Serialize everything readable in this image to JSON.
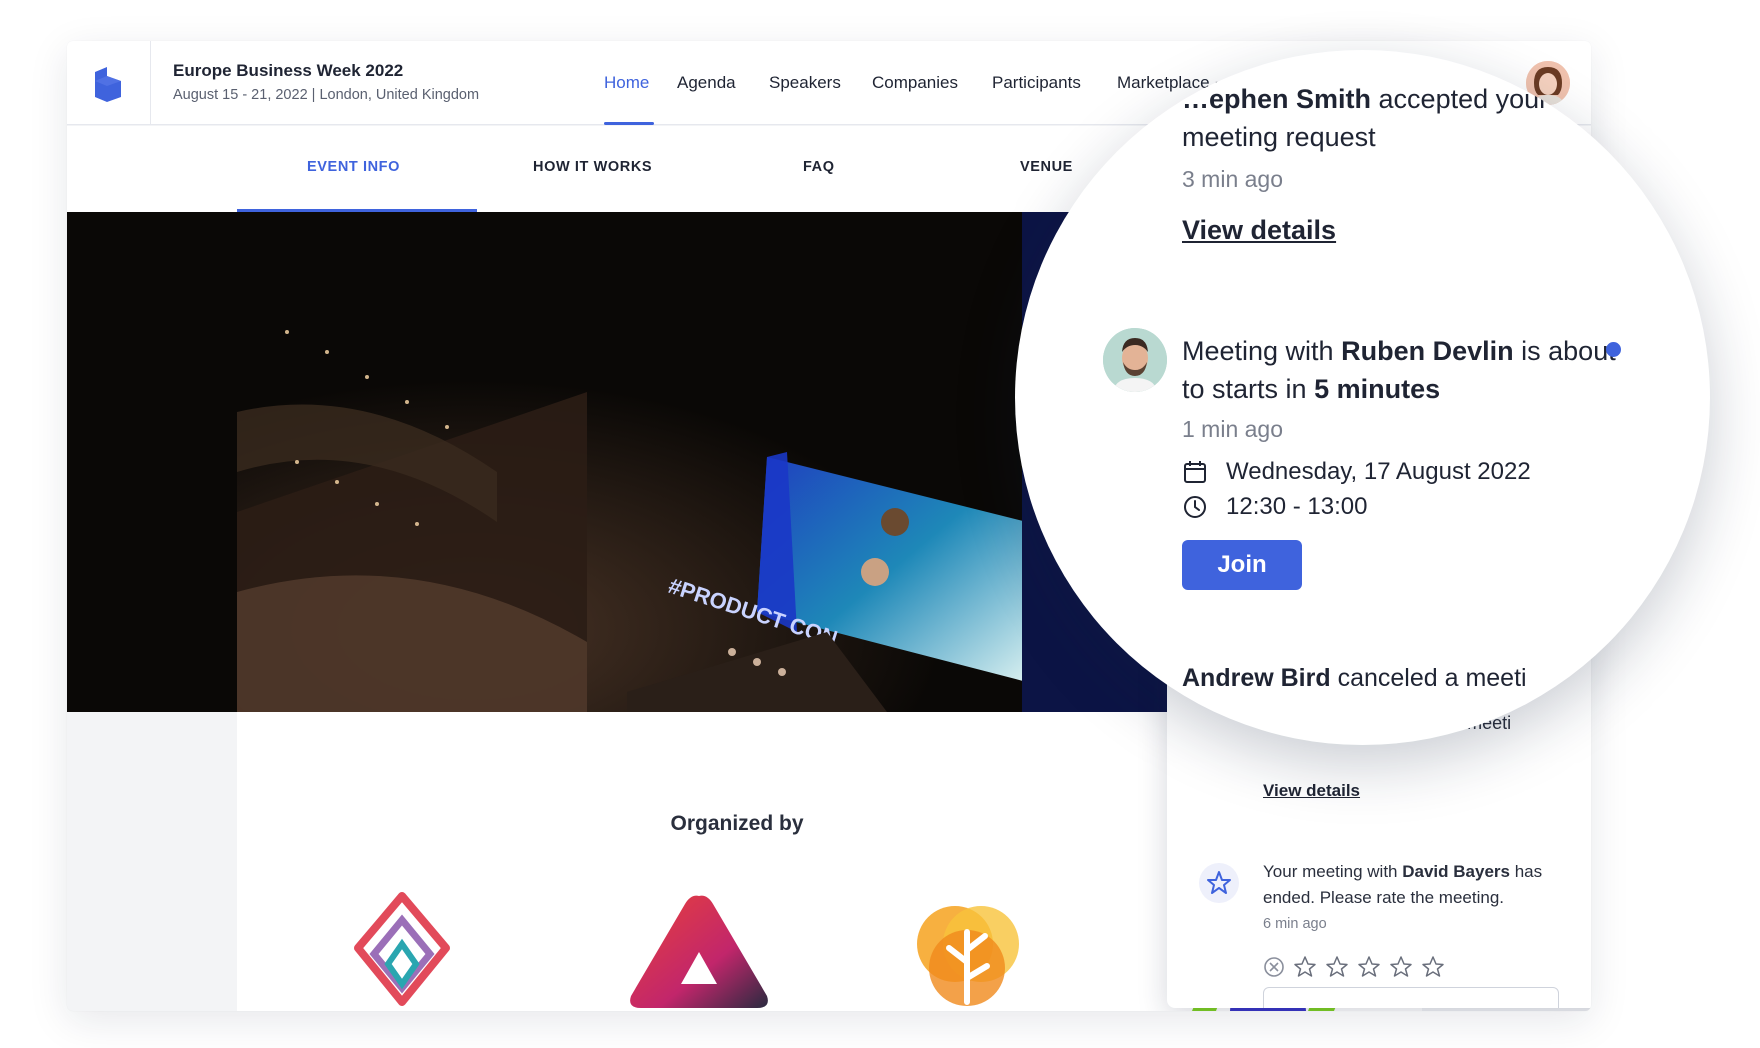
{
  "header": {
    "event_title": "Europe Business Week 2022",
    "event_subtitle": "August 15 - 21, 2022 | London, United Kingdom",
    "nav": [
      {
        "label": "Home",
        "active": true
      },
      {
        "label": "Agenda"
      },
      {
        "label": "Speakers"
      },
      {
        "label": "Companies"
      },
      {
        "label": "Participants"
      },
      {
        "label": "Marketplace"
      }
    ]
  },
  "subnav": {
    "tabs": [
      {
        "label": "EVENT INFO",
        "active": true
      },
      {
        "label": "HOW IT WORKS"
      },
      {
        "label": "FAQ"
      },
      {
        "label": "VENUE"
      }
    ]
  },
  "hero": {
    "screen_text": "#PRODUCT CON"
  },
  "content": {
    "organized_by": "Organized by"
  },
  "notifications": {
    "item1": {
      "name_partial": "…ephen Smith",
      "text": "accepted your",
      "line2": "meeting request",
      "time": "3 min ago",
      "link": "View details"
    },
    "item2": {
      "prefix": "Meeting with",
      "name": "Ruben Devlin",
      "mid": "is about",
      "line2_prefix": "to starts in",
      "line2_bold": "5 minutes",
      "time": "1 min ago",
      "date": "Wednesday, 17 August 2022",
      "time_range": "12:30 - 13:00",
      "join_label": "Join"
    },
    "item3": {
      "name": "Andrew Bird",
      "text": "canceled a meeti",
      "link": "View details"
    },
    "item4": {
      "prefix": "Your meeting with",
      "name": "David Bayers",
      "suffix": "has",
      "line2": "ended. Please rate the meeting.",
      "time": "6 min ago",
      "rating_max": 5
    }
  },
  "colors": {
    "accent": "#3f63dd",
    "hero_dark": "#0a0806",
    "navy": "#0c1445"
  },
  "icons": [
    "brand-logo-icon",
    "bell-icon",
    "calendar-icon",
    "clock-icon",
    "star-icon",
    "close-circle-icon",
    "chevron-down-icon"
  ]
}
